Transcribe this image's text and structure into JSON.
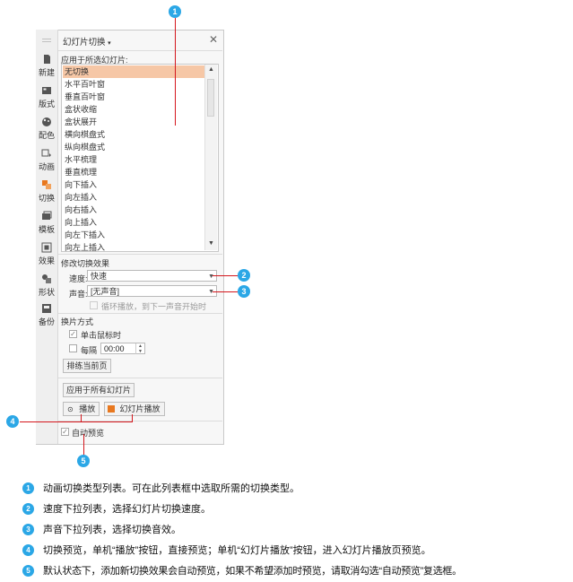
{
  "panel": {
    "title": "幻灯片切换",
    "title_caret": "▾",
    "close": "✕"
  },
  "sidebar": {
    "items": [
      {
        "label": "新建",
        "icon": "new-slide-icon"
      },
      {
        "label": "版式",
        "icon": "layout-icon"
      },
      {
        "label": "配色",
        "icon": "palette-icon"
      },
      {
        "label": "动画",
        "icon": "animation-icon"
      },
      {
        "label": "切换",
        "icon": "transition-icon"
      },
      {
        "label": "模板",
        "icon": "template-icon"
      },
      {
        "label": "效果",
        "icon": "effects-icon"
      },
      {
        "label": "形状",
        "icon": "shapes-icon"
      },
      {
        "label": "备份",
        "icon": "backup-icon"
      }
    ]
  },
  "apply_section": {
    "label": "应用于所选幻灯片:",
    "transitions": [
      "无切换",
      "水平百叶窗",
      "垂直百叶窗",
      "盒状收缩",
      "盒状展开",
      "横向棋盘式",
      "纵向棋盘式",
      "水平梳理",
      "垂直梳理",
      "向下插入",
      "向左插入",
      "向右插入",
      "向上插入",
      "向左下插入",
      "向左上插入"
    ],
    "selected": "无切换"
  },
  "modify_section": {
    "label": "修改切换效果",
    "speed_label": "速度:",
    "speed_value": "快速",
    "sound_label": "声音:",
    "sound_value": "[无声音]",
    "loop_label": "循环播放，到下一声音开始时"
  },
  "advance_section": {
    "label": "换片方式",
    "on_click_label": "单击鼠标时",
    "every_label": "每隔",
    "every_value": "00:00",
    "rehearse_button": "排练当前页"
  },
  "actions": {
    "apply_all_button": "应用于所有幻灯片",
    "play_button": "播放",
    "slideshow_button": "幻灯片播放",
    "autopreview_label": "自动预览"
  },
  "callouts": [
    "1",
    "2",
    "3",
    "4",
    "5"
  ],
  "notes": [
    {
      "num": "1",
      "text": "动画切换类型列表。可在此列表框中选取所需的切换类型。"
    },
    {
      "num": "2",
      "text": "速度下拉列表，选择幻灯片切换速度。"
    },
    {
      "num": "3",
      "text": "声音下拉列表，选择切换音效。"
    },
    {
      "num": "4",
      "text": "切换预览，单机“播放”按钮，直接预览；单机“幻灯片播放”按钮，进入幻灯片播放页预览。"
    },
    {
      "num": "5",
      "text": "默认状态下，添加新切换效果会自动预览，如果不希望添加时预览，请取消勾选“自动预览”复选框。"
    }
  ],
  "colors": {
    "callout": "#2ba7e6",
    "leader_line": "#d4161c",
    "selection": "#f6c7a6"
  }
}
